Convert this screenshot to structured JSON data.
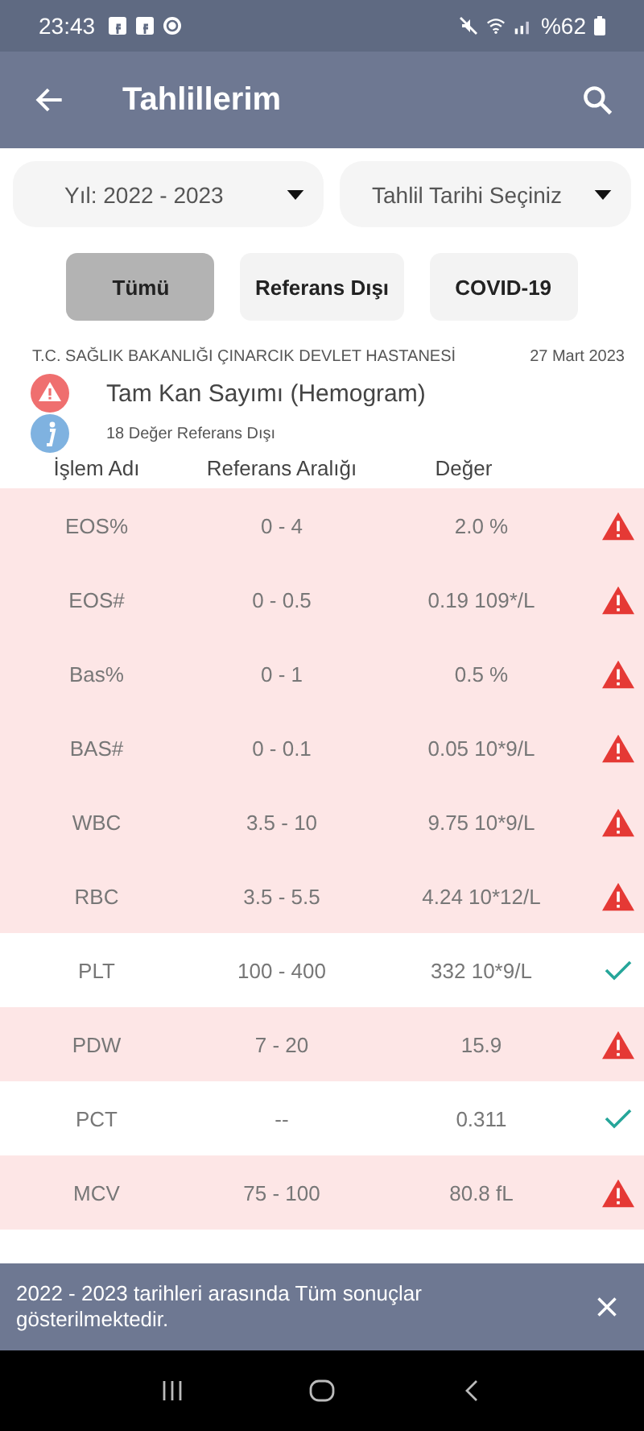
{
  "status_bar": {
    "time": "23:43",
    "battery": "%62"
  },
  "app_bar": {
    "title": "Tahlillerim"
  },
  "filters": [
    {
      "label": "Yıl: 2022 - 2023"
    },
    {
      "label": "Tahlil Tarihi Seçiniz"
    }
  ],
  "tabs": [
    {
      "label": "Tümü",
      "selected": true
    },
    {
      "label": "Referans Dışı",
      "selected": false
    },
    {
      "label": "COVID-19",
      "selected": false
    }
  ],
  "report": {
    "hospital": "T.C. SAĞLIK BAKANLIĞI ÇINARCIK DEVLET HASTANESİ",
    "date": "27 Mart 2023",
    "test_name": "Tam Kan Sayımı (Hemogram)",
    "summary": "18 Değer Referans Dışı"
  },
  "table": {
    "columns": [
      "İşlem Adı",
      "Referans Aralığı",
      "Değer"
    ],
    "rows": [
      {
        "name": "EOS%",
        "range": "0 - 4",
        "value": "2.0 %",
        "out_of_range": true
      },
      {
        "name": "EOS#",
        "range": "0 - 0.5",
        "value": "0.19 109*/L",
        "out_of_range": true
      },
      {
        "name": "Bas%",
        "range": "0 - 1",
        "value": "0.5 %",
        "out_of_range": true
      },
      {
        "name": "BAS#",
        "range": "0 - 0.1",
        "value": "0.05 10*9/L",
        "out_of_range": true
      },
      {
        "name": "WBC",
        "range": "3.5 - 10",
        "value": "9.75 10*9/L",
        "out_of_range": true
      },
      {
        "name": "RBC",
        "range": "3.5 - 5.5",
        "value": "4.24 10*12/L",
        "out_of_range": true
      },
      {
        "name": "PLT",
        "range": "100 - 400",
        "value": "332 10*9/L",
        "out_of_range": false
      },
      {
        "name": "PDW",
        "range": "7 - 20",
        "value": "15.9",
        "out_of_range": true
      },
      {
        "name": "PCT",
        "range": "--",
        "value": "0.311",
        "out_of_range": false
      },
      {
        "name": "MCV",
        "range": "75 - 100",
        "value": "80.8 fL",
        "out_of_range": true
      }
    ]
  },
  "snackbar": {
    "message": "2022 - 2023 tarihleri arasında Tüm sonuçlar gösterilmektedir."
  }
}
